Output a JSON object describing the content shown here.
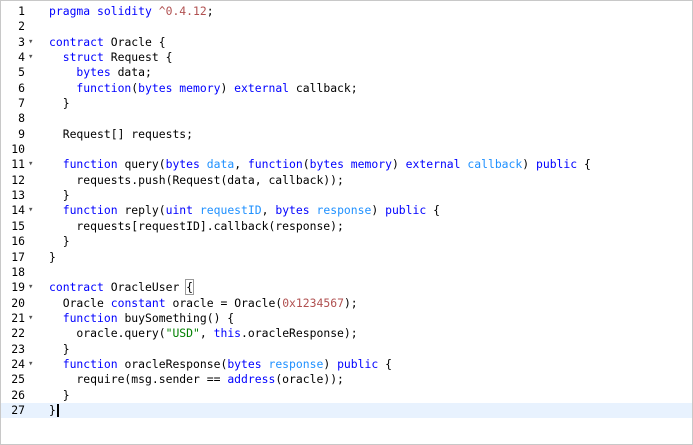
{
  "editor": {
    "language": "solidity",
    "fold_marker": "▾",
    "lines": [
      {
        "n": "1",
        "fold": false,
        "tokens": [
          {
            "t": "pragma solidity ",
            "c": "kw"
          },
          {
            "t": "^0.4.12",
            "c": "num"
          },
          {
            "t": ";",
            "c": "id"
          }
        ]
      },
      {
        "n": "2",
        "fold": false,
        "tokens": []
      },
      {
        "n": "3",
        "fold": true,
        "tokens": [
          {
            "t": "contract ",
            "c": "kw"
          },
          {
            "t": "Oracle {",
            "c": "id"
          }
        ]
      },
      {
        "n": "4",
        "fold": true,
        "tokens": [
          {
            "t": "  struct ",
            "c": "kw"
          },
          {
            "t": "Request {",
            "c": "id"
          }
        ]
      },
      {
        "n": "5",
        "fold": false,
        "tokens": [
          {
            "t": "    bytes ",
            "c": "kw"
          },
          {
            "t": "data;",
            "c": "id"
          }
        ]
      },
      {
        "n": "6",
        "fold": false,
        "tokens": [
          {
            "t": "    function",
            "c": "kw"
          },
          {
            "t": "(",
            "c": "id"
          },
          {
            "t": "bytes memory",
            "c": "kw"
          },
          {
            "t": ") ",
            "c": "id"
          },
          {
            "t": "external ",
            "c": "kw"
          },
          {
            "t": "callback;",
            "c": "id"
          }
        ]
      },
      {
        "n": "7",
        "fold": false,
        "tokens": [
          {
            "t": "  }",
            "c": "id"
          }
        ]
      },
      {
        "n": "8",
        "fold": false,
        "tokens": []
      },
      {
        "n": "9",
        "fold": false,
        "tokens": [
          {
            "t": "  Request[] requests;",
            "c": "id"
          }
        ]
      },
      {
        "n": "10",
        "fold": false,
        "tokens": []
      },
      {
        "n": "11",
        "fold": true,
        "tokens": [
          {
            "t": "  function ",
            "c": "kw"
          },
          {
            "t": "query(",
            "c": "id"
          },
          {
            "t": "bytes ",
            "c": "kw"
          },
          {
            "t": "data",
            "c": "ty"
          },
          {
            "t": ", ",
            "c": "id"
          },
          {
            "t": "function",
            "c": "kw"
          },
          {
            "t": "(",
            "c": "id"
          },
          {
            "t": "bytes memory",
            "c": "kw"
          },
          {
            "t": ") ",
            "c": "id"
          },
          {
            "t": "external ",
            "c": "kw"
          },
          {
            "t": "callback",
            "c": "ty"
          },
          {
            "t": ") ",
            "c": "id"
          },
          {
            "t": "public",
            "c": "kw"
          },
          {
            "t": " {",
            "c": "id"
          }
        ]
      },
      {
        "n": "12",
        "fold": false,
        "tokens": [
          {
            "t": "    requests.push(Request(data, callback));",
            "c": "id"
          }
        ]
      },
      {
        "n": "13",
        "fold": false,
        "tokens": [
          {
            "t": "  }",
            "c": "id"
          }
        ]
      },
      {
        "n": "14",
        "fold": true,
        "tokens": [
          {
            "t": "  function ",
            "c": "kw"
          },
          {
            "t": "reply(",
            "c": "id"
          },
          {
            "t": "uint ",
            "c": "kw"
          },
          {
            "t": "requestID",
            "c": "ty"
          },
          {
            "t": ", ",
            "c": "id"
          },
          {
            "t": "bytes ",
            "c": "kw"
          },
          {
            "t": "response",
            "c": "ty"
          },
          {
            "t": ") ",
            "c": "id"
          },
          {
            "t": "public",
            "c": "kw"
          },
          {
            "t": " {",
            "c": "id"
          }
        ]
      },
      {
        "n": "15",
        "fold": false,
        "tokens": [
          {
            "t": "    requests[requestID].callback(response);",
            "c": "id"
          }
        ]
      },
      {
        "n": "16",
        "fold": false,
        "tokens": [
          {
            "t": "  }",
            "c": "id"
          }
        ]
      },
      {
        "n": "17",
        "fold": false,
        "tokens": [
          {
            "t": "}",
            "c": "id"
          }
        ]
      },
      {
        "n": "18",
        "fold": false,
        "tokens": []
      },
      {
        "n": "19",
        "fold": true,
        "tokens": [
          {
            "t": "contract ",
            "c": "kw"
          },
          {
            "t": "OracleUser ",
            "c": "id"
          },
          {
            "t": "{",
            "c": "bracket"
          }
        ]
      },
      {
        "n": "20",
        "fold": false,
        "tokens": [
          {
            "t": "  Oracle ",
            "c": "id"
          },
          {
            "t": "constant ",
            "c": "kw"
          },
          {
            "t": "oracle = Oracle(",
            "c": "id"
          },
          {
            "t": "0x1234567",
            "c": "num"
          },
          {
            "t": ");",
            "c": "id"
          }
        ]
      },
      {
        "n": "21",
        "fold": true,
        "tokens": [
          {
            "t": "  function ",
            "c": "kw"
          },
          {
            "t": "buySomething() {",
            "c": "id"
          }
        ]
      },
      {
        "n": "22",
        "fold": false,
        "tokens": [
          {
            "t": "    oracle.query(",
            "c": "id"
          },
          {
            "t": "\"USD\"",
            "c": "str"
          },
          {
            "t": ", ",
            "c": "id"
          },
          {
            "t": "this",
            "c": "kw"
          },
          {
            "t": ".oracleResponse);",
            "c": "id"
          }
        ]
      },
      {
        "n": "23",
        "fold": false,
        "tokens": [
          {
            "t": "  }",
            "c": "id"
          }
        ]
      },
      {
        "n": "24",
        "fold": true,
        "tokens": [
          {
            "t": "  function ",
            "c": "kw"
          },
          {
            "t": "oracleResponse(",
            "c": "id"
          },
          {
            "t": "bytes ",
            "c": "kw"
          },
          {
            "t": "response",
            "c": "ty"
          },
          {
            "t": ") ",
            "c": "id"
          },
          {
            "t": "public",
            "c": "kw"
          },
          {
            "t": " {",
            "c": "id"
          }
        ]
      },
      {
        "n": "25",
        "fold": false,
        "tokens": [
          {
            "t": "    require(msg.sender == ",
            "c": "id"
          },
          {
            "t": "address",
            "c": "kw"
          },
          {
            "t": "(oracle));",
            "c": "id"
          }
        ]
      },
      {
        "n": "26",
        "fold": false,
        "tokens": [
          {
            "t": "  }",
            "c": "id"
          }
        ]
      },
      {
        "n": "27",
        "fold": false,
        "active": true,
        "cursor": true,
        "tokens": [
          {
            "t": "}",
            "c": "id"
          }
        ]
      }
    ]
  }
}
